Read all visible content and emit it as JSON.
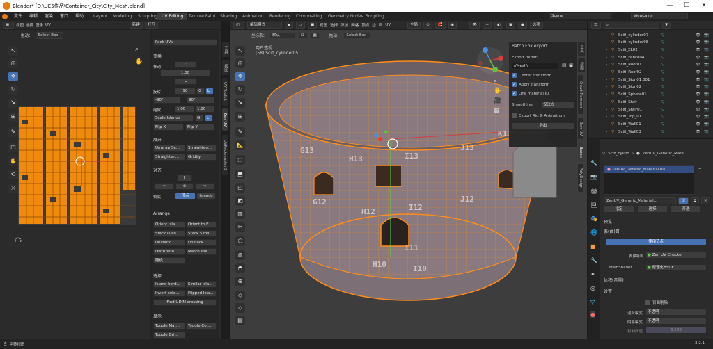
{
  "window": {
    "title": "Blender* [D:\\UE5作品\\Container_City\\City_Mesh.blend]",
    "min": "—",
    "max": "☐",
    "close": "✕"
  },
  "menu": [
    "文件",
    "编辑",
    "渲染",
    "窗口",
    "帮助"
  ],
  "workspaces": [
    "Layout",
    "Modeling",
    "Sculpting",
    "UV Editing",
    "Texture Paint",
    "Shading",
    "Animation",
    "Rendering",
    "Compositing",
    "Geometry Nodes",
    "Scripting"
  ],
  "scene": {
    "scene": "Scene",
    "viewlayer": "ViewLayer"
  },
  "uv_editor": {
    "menus": [
      "视图",
      "选择",
      "图像",
      "UV"
    ],
    "new_label": "新建",
    "open_label": "打开",
    "drag_label": "拖动：",
    "select_mode": "Select Box"
  },
  "zenuv_panel": {
    "pack": "Pack UVs",
    "transform": "变换",
    "move": "移动",
    "move_val": "1.00",
    "rotate": "旋转",
    "rot_val": "90",
    "rot_g": "G",
    "rot_l": "L",
    "rot_neg": "-90°",
    "rot_pos": "90°",
    "scale": "缩放",
    "scale_x": "1.00",
    "scale_y": "1.00",
    "scale_islands": "Scale Islands",
    "flip_x": "Flip X",
    "flip_y": "Flip Y",
    "unwrap": "展开",
    "unwrap_sel": "Unwrap Se...",
    "straighten1": "Straighten...",
    "straighten2": "Straighten...",
    "gridify": "Gridify",
    "align": "对齐",
    "mode": "模式",
    "mode_vertex": "顶点",
    "mode_islands": "Islands",
    "arrange": "Arrange",
    "arr": [
      "Orient Isla...",
      "Orient to E...",
      "Stack Islan...",
      "Stack Simil...",
      "Unstack",
      "Unstack O...",
      "Distribute",
      "Match isla...",
      "随机"
    ],
    "select": "选择",
    "sel": [
      "Island bord...",
      "Similar Isla...",
      "Invert sele...",
      "Flipped Isla...",
      "Find UDIM crossing"
    ],
    "display": "显示",
    "disp": [
      "Toggle Mat...",
      "Toggle Col...",
      "Toggle Gri..."
    ]
  },
  "uv_tabs": [
    "工具",
    "视图",
    "UV Toolkit",
    "Zen UV",
    "UVPackmaster3"
  ],
  "viewport": {
    "mode": "编辑模式",
    "menus": [
      "视图",
      "选择",
      "添加",
      "网格",
      "顶点",
      "边",
      "面",
      "UV"
    ],
    "coord": "坐标系：",
    "coord_val": "默认",
    "drag": "拖动：",
    "select_mode": "Select Box",
    "view_name": "用户透视",
    "object": "(58) Scifi_cylinder05",
    "global": "全局",
    "options": "选项",
    "uv_tags": [
      "G13",
      "H13",
      "I13",
      "J13",
      "G12",
      "H12",
      "I12",
      "J12",
      "I11",
      "I10",
      "H10",
      "K13"
    ]
  },
  "batch_fbx": {
    "title": "Batch Fbx export",
    "folder_label": "Export folder:",
    "folder": "//Mesh\\",
    "center": "Center transform",
    "apply": "Apply transform",
    "onemat": "One material ID",
    "smoothing_label": "Smoothing:",
    "smoothing": "仅法向",
    "rig": "Export Rig & Animations",
    "export": "导出"
  },
  "vp_tabs": [
    "工具",
    "视图",
    "Quad Remesh",
    "Zen UV",
    "Batex",
    "PolyDesign"
  ],
  "outliner": [
    {
      "name": "Scifi_cylinder07"
    },
    {
      "name": "Scifi_cylinder08"
    },
    {
      "name": "Scifi_EL02"
    },
    {
      "name": "Scifi_Fence04"
    },
    {
      "name": "Scifi_Roof01"
    },
    {
      "name": "Scifi_Roof02"
    },
    {
      "name": "Scifi_Sign01.001"
    },
    {
      "name": "Scifi_Sign02"
    },
    {
      "name": "Scifi_Sphere01"
    },
    {
      "name": "Scifi_Stair"
    },
    {
      "name": "Scifi_Stair01"
    },
    {
      "name": "Scifi_Top_01"
    },
    {
      "name": "Scifi_Wall01"
    },
    {
      "name": "Scifi_Wall03"
    }
  ],
  "properties": {
    "obj": "Scifi_cylind",
    "mat": "ZenUV_Generic_Mate...",
    "slot": "ZenUV_Generic_Material.001",
    "matname": "ZenUV_Generic_Material...",
    "assign": "指定",
    "select": "选择",
    "deselect": "弃选",
    "preview": "预览",
    "surface": "表(曲)面",
    "usenodes": "使用节点",
    "surface_lbl": "表(曲)面",
    "surface_val": "Zen UV Checker",
    "mainshader_lbl": "MainShader",
    "mainshader_val": "原理化BSDF",
    "volume": "体积(音量)",
    "settings": "设置",
    "backface": "背面剔除",
    "blend_lbl": "混合模式",
    "blend_val": "不透明",
    "shadow_lbl": "阴影模式",
    "shadow_val": "不透明",
    "clip_lbl": "钳制阈值",
    "clip_val": "0.500"
  },
  "status": {
    "left": "平移视图",
    "version": "3.2.1"
  }
}
